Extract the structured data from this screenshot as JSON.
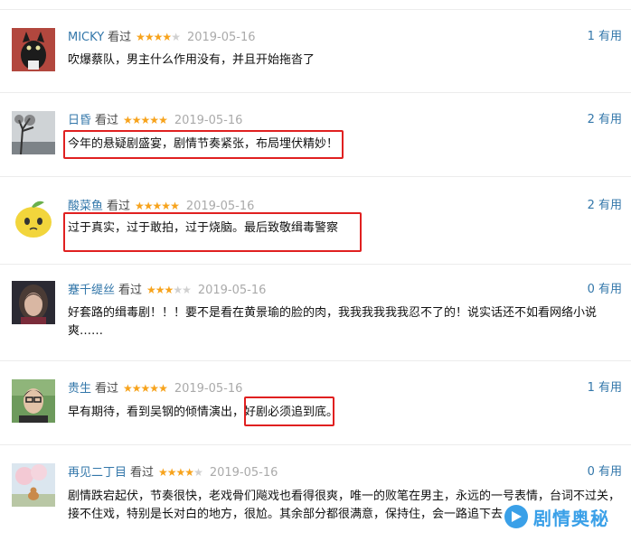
{
  "comments": [
    {
      "user": "MICKY",
      "action": "看过",
      "stars": 4,
      "date": "2019-05-16",
      "useful": "1 有用",
      "text": "吹爆蔡队，男主什么作用没有，并且开始拖沓了",
      "avatar": "cat"
    },
    {
      "user": "日昏",
      "action": "看过",
      "stars": 5,
      "date": "2019-05-16",
      "useful": "2 有用",
      "text": "今年的悬疑剧盛宴，剧情节奏紧张，布局埋伏精妙！",
      "avatar": "tree"
    },
    {
      "user": "酸菜鱼",
      "action": "看过",
      "stars": 5,
      "date": "2019-05-16",
      "useful": "2 有用",
      "text": "过于真实，过于敢拍，过于烧脑。最后致敬缉毒警察",
      "avatar": "lemon"
    },
    {
      "user": "蹇千缇丝",
      "action": "看过",
      "stars": 3,
      "date": "2019-05-16",
      "useful": "0 有用",
      "text": "好套路的缉毒剧！！！要不是看在黄景瑜的脸的肉，我我我我我我忍不了的！说实话还不如看网络小说爽……",
      "avatar": "woman"
    },
    {
      "user": "贵生",
      "action": "看过",
      "stars": 5,
      "date": "2019-05-16",
      "useful": "1 有用",
      "text": "早有期待，看到吴钢的倾情演出，好剧必须追到底。",
      "avatar": "man"
    },
    {
      "user": "再见二丁目",
      "action": "看过",
      "stars": 4,
      "date": "2019-05-16",
      "useful": "0 有用",
      "text": "剧情跌宕起伏，节奏很快，老戏骨们飚戏也看得很爽，唯一的败笔在男主，永远的一号表情，台词不过关，接不住戏，特别是长对白的地方，很尬。其余部分都很满意，保持住，会一路追下去",
      "avatar": "cherry"
    }
  ],
  "watermark": "剧情奥秘",
  "colors": {
    "username": "#3377aa",
    "star": "#f7a31c",
    "highlight": "#e02020",
    "watermark": "#3aa0e8"
  }
}
